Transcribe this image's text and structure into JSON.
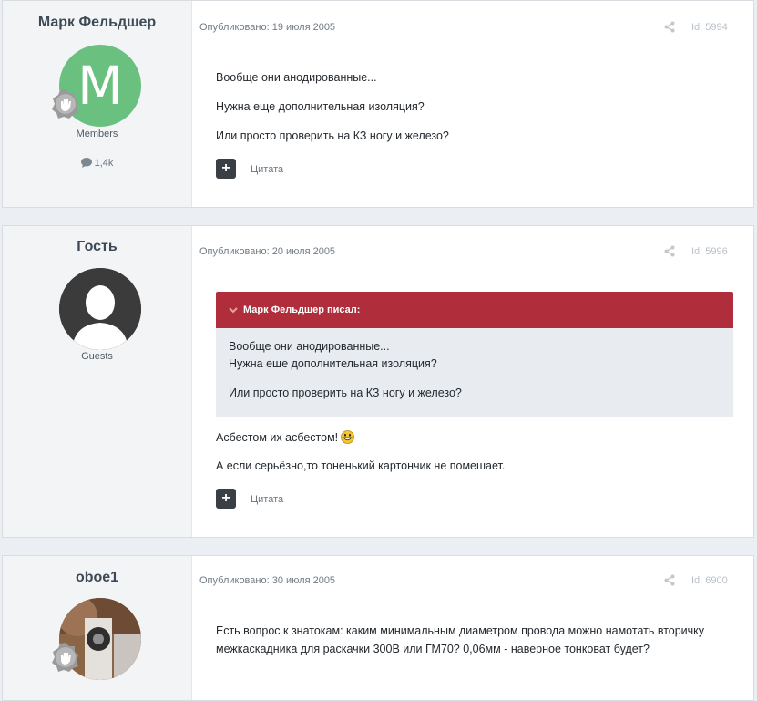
{
  "posts": [
    {
      "author": "Марк Фельдшер",
      "avatar_letter": "M",
      "avatar_color": "#6ac07f",
      "group": "Members",
      "post_count": "1,4k",
      "published": "Опубликовано: 19 июля 2005",
      "id_label": "Id: 5994",
      "lines": [
        "Вообще они анодированные...",
        "Нужна еще дополнительная изоляция?",
        "Или просто проверить на КЗ ногу и железо?"
      ],
      "quote_label": "Цитата"
    },
    {
      "author": "Гость",
      "group": "Guests",
      "published": "Опубликовано: 20 июля 2005",
      "id_label": "Id: 5996",
      "quote_block": {
        "header": "Марк Фельдшер писал:",
        "lines": [
          "Вообще они анодированные...",
          "Нужна еще дополнительная изоляция?",
          "Или просто проверить на КЗ ногу и железо?"
        ]
      },
      "lines": [
        "Асбестом их асбестом!",
        "А если серьёзно,то тоненький картончик не помешает."
      ],
      "quote_label": "Цитата"
    },
    {
      "author": "oboe1",
      "published": "Опубликовано: 30 июля 2005",
      "id_label": "Id: 6900",
      "text": "Есть вопрос к знатокам: каким минимальным диаметром провода можно намотать вторичку межкаскадника для раскачки 300В или ГМ70? 0,06мм - наверное тонковат будет?"
    }
  ],
  "colors": {
    "quote_header": "#b02e3b",
    "quote_body": "#e8ecf0",
    "author_panel": "#f3f4f6"
  }
}
